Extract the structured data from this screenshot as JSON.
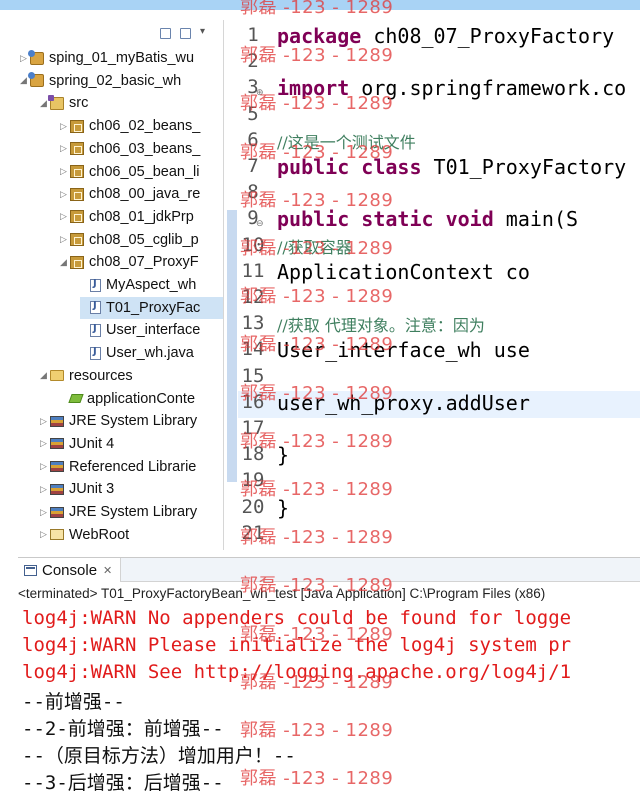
{
  "explorer": {
    "items": [
      {
        "label": "sping_01_myBatis_wu",
        "icon": "project-icon",
        "depth": 1,
        "twisty": "▷"
      },
      {
        "label": "spring_02_basic_wh",
        "icon": "project-icon",
        "depth": 1,
        "twisty": "◢"
      },
      {
        "label": "src",
        "icon": "source-folder-icon",
        "depth": 2,
        "twisty": "◢"
      },
      {
        "label": "ch06_02_beans_",
        "icon": "package-icon",
        "depth": 3,
        "twisty": "▷"
      },
      {
        "label": "ch06_03_beans_",
        "icon": "package-icon",
        "depth": 3,
        "twisty": "▷"
      },
      {
        "label": "ch06_05_bean_li",
        "icon": "package-icon",
        "depth": 3,
        "twisty": "▷"
      },
      {
        "label": "ch08_00_java_re",
        "icon": "package-icon",
        "depth": 3,
        "twisty": "▷"
      },
      {
        "label": "ch08_01_jdkPrp",
        "icon": "package-icon",
        "depth": 3,
        "twisty": "▷"
      },
      {
        "label": "ch08_05_cglib_p",
        "icon": "package-icon",
        "depth": 3,
        "twisty": "▷"
      },
      {
        "label": "ch08_07_ProxyF",
        "icon": "package-icon",
        "depth": 3,
        "twisty": "◢"
      },
      {
        "label": "MyAspect_wh",
        "icon": "java-file-icon",
        "depth": 4,
        "twisty": ""
      },
      {
        "label": "T01_ProxyFac",
        "icon": "java-file-icon",
        "depth": 4,
        "twisty": "",
        "selected": true
      },
      {
        "label": "User_interface",
        "icon": "java-file-icon",
        "depth": 4,
        "twisty": ""
      },
      {
        "label": "User_wh.java",
        "icon": "java-file-icon",
        "depth": 4,
        "twisty": ""
      },
      {
        "label": "resources",
        "icon": "folder-icon",
        "depth": 2,
        "twisty": "◢"
      },
      {
        "label": "applicationConte",
        "icon": "xml-file-icon",
        "depth": 3,
        "twisty": ""
      },
      {
        "label": "JRE System Library",
        "icon": "library-icon",
        "depth": 2,
        "twisty": "▷"
      },
      {
        "label": "JUnit 4",
        "icon": "library-icon",
        "depth": 2,
        "twisty": "▷"
      },
      {
        "label": "Referenced Librarie",
        "icon": "library-icon",
        "depth": 2,
        "twisty": "▷"
      },
      {
        "label": "JUnit 3",
        "icon": "library-icon",
        "depth": 2,
        "twisty": "▷"
      },
      {
        "label": "JRE System Library",
        "icon": "library-icon",
        "depth": 2,
        "twisty": "▷"
      },
      {
        "label": "WebRoot",
        "icon": "web-folder-icon",
        "depth": 2,
        "twisty": "▷"
      }
    ]
  },
  "editor": {
    "lines": [
      {
        "num": "1",
        "parts": [
          {
            "t": "package",
            "c": "kw"
          },
          {
            "t": " ch08_07_ProxyFactory",
            "c": ""
          }
        ]
      },
      {
        "num": "2",
        "parts": []
      },
      {
        "num": "3",
        "fold": "⊕",
        "parts": [
          {
            "t": "import",
            "c": "kw"
          },
          {
            "t": " org.springframework.co",
            "c": ""
          }
        ]
      },
      {
        "num": "5",
        "parts": []
      },
      {
        "num": "6",
        "parts": [
          {
            "t": "//这是一个测试文件",
            "c": "comment"
          }
        ]
      },
      {
        "num": "7",
        "parts": [
          {
            "t": "public",
            "c": "kw"
          },
          {
            "t": " ",
            "c": ""
          },
          {
            "t": "class",
            "c": "kw"
          },
          {
            "t": " T01_ProxyFactory",
            "c": ""
          }
        ]
      },
      {
        "num": "8",
        "parts": []
      },
      {
        "num": "9",
        "fold": "⊖",
        "parts": [
          {
            "t": "    ",
            "c": ""
          },
          {
            "t": "public",
            "c": "kw"
          },
          {
            "t": " ",
            "c": ""
          },
          {
            "t": "static",
            "c": "kw"
          },
          {
            "t": " ",
            "c": ""
          },
          {
            "t": "void",
            "c": "kw"
          },
          {
            "t": " main(S",
            "c": ""
          }
        ]
      },
      {
        "num": "10",
        "parts": [
          {
            "t": "        ",
            "c": ""
          },
          {
            "t": "//获取容器",
            "c": "comment"
          }
        ]
      },
      {
        "num": "11",
        "parts": [
          {
            "t": "        ApplicationContext co",
            "c": ""
          }
        ]
      },
      {
        "num": "12",
        "parts": []
      },
      {
        "num": "13",
        "parts": [
          {
            "t": "        ",
            "c": ""
          },
          {
            "t": "//获取 代理对象。注意：因为",
            "c": "comment"
          }
        ]
      },
      {
        "num": "14",
        "parts": [
          {
            "t": "        User_interface_wh use",
            "c": ""
          }
        ]
      },
      {
        "num": "15",
        "parts": []
      },
      {
        "num": "16",
        "current": true,
        "parts": [
          {
            "t": "        user_wh_proxy.addUser",
            "c": ""
          }
        ]
      },
      {
        "num": "17",
        "parts": []
      },
      {
        "num": "18",
        "parts": [
          {
            "t": "    }",
            "c": ""
          }
        ]
      },
      {
        "num": "19",
        "parts": []
      },
      {
        "num": "20",
        "parts": [
          {
            "t": "}",
            "c": ""
          }
        ]
      },
      {
        "num": "21",
        "parts": []
      }
    ]
  },
  "console": {
    "tab_label": "Console",
    "close_glyph": "✕",
    "terminated": "<terminated> T01_ProxyFactoryBean_wh_test [Java Application] C:\\Program Files (x86)",
    "output": [
      {
        "text": "log4j:WARN No appenders could be found for logge",
        "kind": "err"
      },
      {
        "text": "log4j:WARN Please initialize the log4j system pr",
        "kind": "err"
      },
      {
        "text": "log4j:WARN See http://logging.apache.org/log4j/1",
        "kind": "err"
      },
      {
        "text": "--前增强--",
        "kind": "std"
      },
      {
        "text": "--2-前增强：前增强--",
        "kind": "std"
      },
      {
        "text": "--（原目标方法）增加用户！--",
        "kind": "std"
      },
      {
        "text": "--3-后增强：后增强--",
        "kind": "std"
      }
    ]
  },
  "watermark": {
    "text": "郭磊 -123 - 1289"
  },
  "colors": {
    "keyword": "#7f0055",
    "comment": "#3f7f5f",
    "console_error": "#e11b1b",
    "selection": "#cfe3f5",
    "current_line": "#e8f2fe",
    "top_bar": "#a9d3f5"
  }
}
